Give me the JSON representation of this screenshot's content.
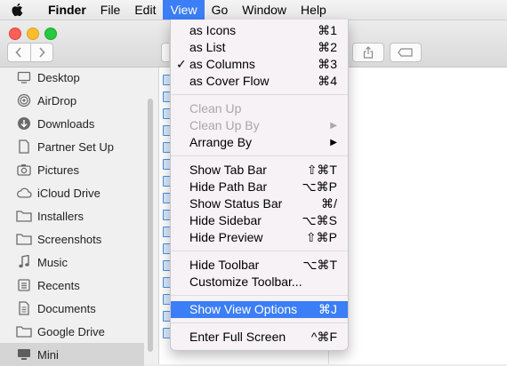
{
  "menubar": {
    "apple": "",
    "items": [
      {
        "label": "Finder"
      },
      {
        "label": "File"
      },
      {
        "label": "Edit"
      },
      {
        "label": "View"
      },
      {
        "label": "Go"
      },
      {
        "label": "Window"
      },
      {
        "label": "Help"
      }
    ],
    "active": "View"
  },
  "sidebar": {
    "items": [
      {
        "label": "Desktop",
        "icon": "desktop-icon"
      },
      {
        "label": "AirDrop",
        "icon": "airdrop-icon"
      },
      {
        "label": "Downloads",
        "icon": "downloads-icon"
      },
      {
        "label": "Partner Set Up",
        "icon": "document-icon"
      },
      {
        "label": "Pictures",
        "icon": "camera-icon"
      },
      {
        "label": "iCloud Drive",
        "icon": "cloud-icon"
      },
      {
        "label": "Installers",
        "icon": "folder-icon"
      },
      {
        "label": "Screenshots",
        "icon": "folder-icon"
      },
      {
        "label": "Music",
        "icon": "music-icon"
      },
      {
        "label": "Recents",
        "icon": "recents-icon"
      },
      {
        "label": "Documents",
        "icon": "document-icon"
      },
      {
        "label": "Google Drive",
        "icon": "folder-icon"
      },
      {
        "label": "Mini",
        "icon": "computer-icon"
      }
    ],
    "selected": "Mini"
  },
  "view_menu": {
    "items": [
      {
        "label": "as Icons",
        "shortcut": "⌘1"
      },
      {
        "label": "as List",
        "shortcut": "⌘2"
      },
      {
        "label": "as Columns",
        "shortcut": "⌘3",
        "checked": true
      },
      {
        "label": "as Cover Flow",
        "shortcut": "⌘4"
      },
      {
        "label": "Clean Up",
        "disabled": true
      },
      {
        "label": "Clean Up By",
        "disabled": true,
        "submenu": true
      },
      {
        "label": "Arrange By",
        "submenu": true
      },
      {
        "label": "Show Tab Bar",
        "shortcut": "⇧⌘T"
      },
      {
        "label": "Hide Path Bar",
        "shortcut": "⌥⌘P"
      },
      {
        "label": "Show Status Bar",
        "shortcut": "⌘/"
      },
      {
        "label": "Hide Sidebar",
        "shortcut": "⌥⌘S"
      },
      {
        "label": "Hide Preview",
        "shortcut": "⇧⌘P"
      },
      {
        "label": "Hide Toolbar",
        "shortcut": "⌥⌘T"
      },
      {
        "label": "Customize Toolbar..."
      },
      {
        "label": "Show View Options",
        "shortcut": "⌘J",
        "highlighted": true
      },
      {
        "label": "Enter Full Screen",
        "shortcut": "^⌘F"
      }
    ],
    "check_mark": "✓",
    "submenu_arrow": "▶"
  },
  "colors": {
    "accent": "#3b7ef5",
    "close": "#fc5f57",
    "minimize": "#fdbc2e",
    "zoom": "#28c841"
  }
}
